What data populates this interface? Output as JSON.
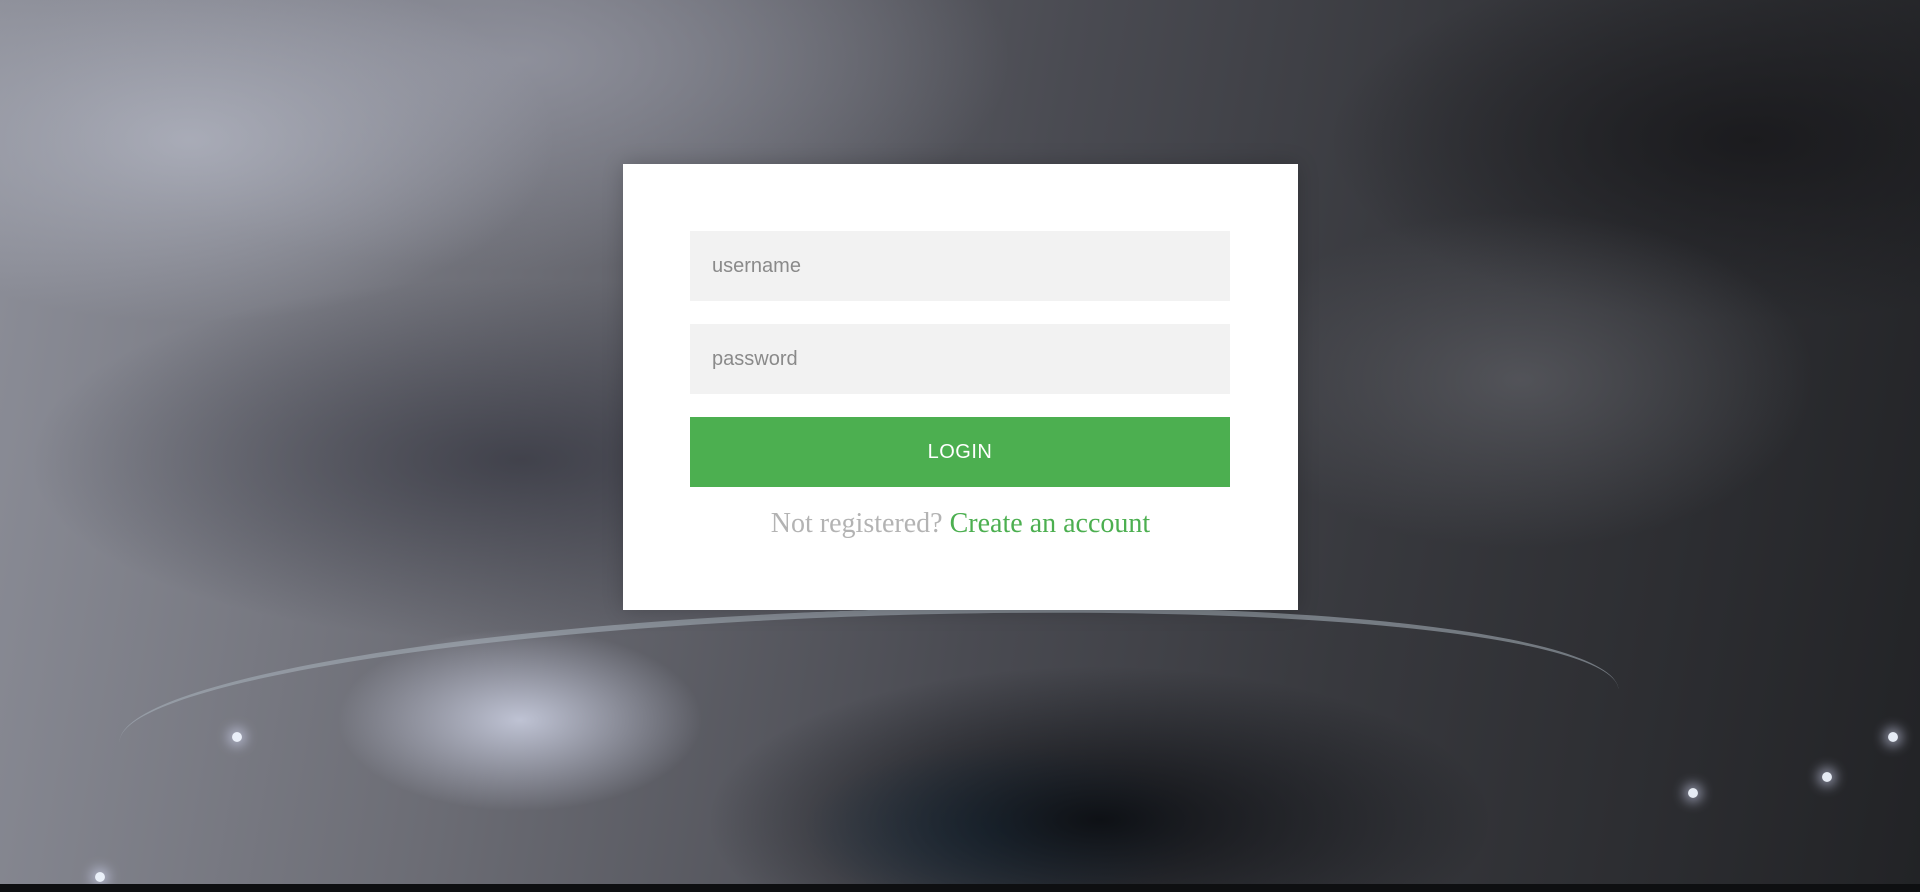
{
  "login_form": {
    "username_placeholder": "username",
    "password_placeholder": "password",
    "login_label": "LOGIN",
    "register_prompt": "Not registered?",
    "register_link": "Create an account"
  },
  "colors": {
    "accent": "#4caf50",
    "card_background": "#ffffff",
    "field_background": "#f2f2f2",
    "muted_text": "#b3b3b3"
  }
}
